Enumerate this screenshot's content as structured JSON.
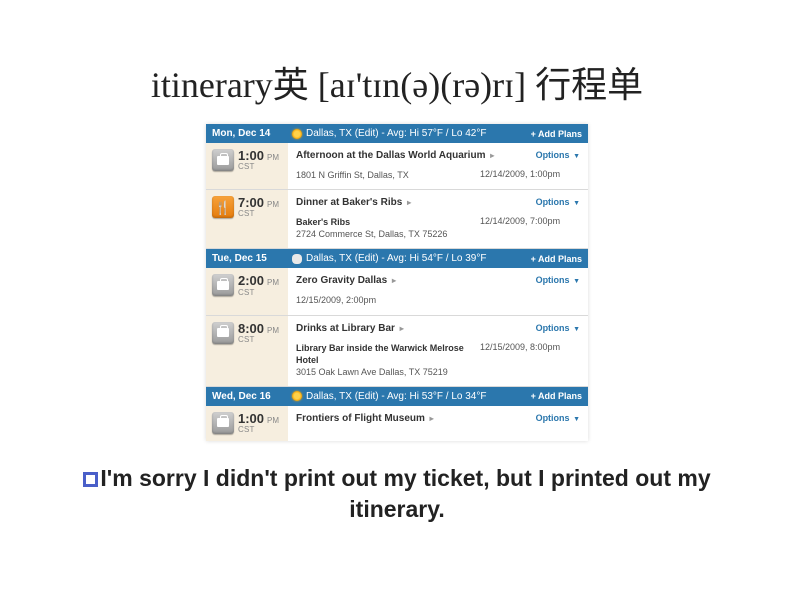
{
  "title_line": "itinerary英 [aɪ'tɪn(ə)(rə)rɪ] 行程单",
  "itinerary": {
    "add_plans_label": "+ Add Plans",
    "options_label": "Options",
    "tz": "CST",
    "days": [
      {
        "date": "Mon, Dec 14",
        "weather_icon": "sun",
        "weather_text": "Dallas, TX (Edit) - Avg: Hi 57°F / Lo 42°F",
        "events": [
          {
            "icon": "suitcase",
            "time": "1:00",
            "ampm": "PM",
            "title": "Afternoon at the Dallas World Aquarium",
            "venue": "",
            "address": "1801 N Griffin St, Dallas, TX",
            "datetime": "12/14/2009, 1:00pm"
          },
          {
            "icon": "food",
            "time": "7:00",
            "ampm": "PM",
            "title": "Dinner at Baker's Ribs",
            "venue": "Baker's Ribs",
            "address": "2724 Commerce St, Dallas, TX 75226",
            "datetime": "12/14/2009, 7:00pm"
          }
        ]
      },
      {
        "date": "Tue, Dec 15",
        "weather_icon": "cloud",
        "weather_text": "Dallas, TX (Edit) - Avg: Hi 54°F / Lo 39°F",
        "events": [
          {
            "icon": "suitcase",
            "time": "2:00",
            "ampm": "PM",
            "title": "Zero Gravity Dallas",
            "venue": "",
            "address": "",
            "datetime": "12/15/2009, 2:00pm"
          },
          {
            "icon": "suitcase",
            "time": "8:00",
            "ampm": "PM",
            "title": "Drinks at Library Bar",
            "venue": "Library Bar inside the Warwick Melrose Hotel",
            "address": "3015 Oak Lawn Ave Dallas, TX 75219",
            "datetime": "12/15/2009, 8:00pm"
          }
        ]
      },
      {
        "date": "Wed, Dec 16",
        "weather_icon": "sun",
        "weather_text": "Dallas, TX (Edit) - Avg: Hi 53°F / Lo 34°F",
        "events": [
          {
            "icon": "suitcase",
            "time": "1:00",
            "ampm": "PM",
            "title": "Frontiers of Flight Museum",
            "venue": "",
            "address": "",
            "datetime": ""
          }
        ]
      }
    ]
  },
  "sentence": "I'm sorry I didn't print out my ticket, but I printed out my itinerary."
}
